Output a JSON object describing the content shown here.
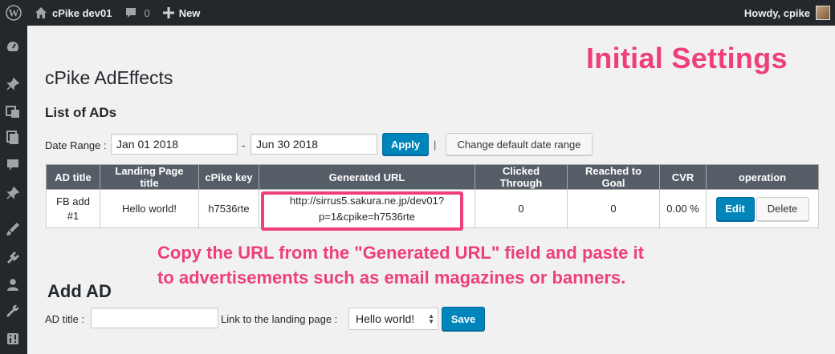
{
  "adminbar": {
    "site_name": "cPike dev01",
    "comments_count": "0",
    "new_label": "New",
    "greeting": "Howdy, cpike"
  },
  "annotations": {
    "title": "Initial Settings",
    "line1": "Copy the URL from the \"Generated URL\" field and paste it",
    "line2": "to advertisements such as email magazines or banners.",
    "color": "#ee3f7c"
  },
  "page": {
    "title": "cPike AdEffects",
    "list_heading": "List of ADs"
  },
  "date_range": {
    "label": "Date Range :",
    "start": "Jan 01 2018",
    "separator": "-",
    "end": "Jun 30 2018",
    "apply_label": "Apply",
    "divider": "|",
    "default_label": "Change default date range"
  },
  "table": {
    "headers": [
      "AD title",
      "Landing Page title",
      "cPike key",
      "Generated URL",
      "Clicked Through",
      "Reached to Goal",
      "CVR",
      "operation"
    ],
    "rows": [
      {
        "ad_title_line1": "FB add",
        "ad_title_line2": "#1",
        "landing_page": "Hello world!",
        "key": "h7536rte",
        "url_line1": "http://sirrus5.sakura.ne.jp/dev01?",
        "url_line2": "p=1&cpike=h7536rte",
        "clicked": "0",
        "reached": "0",
        "cvr": "0.00 %",
        "edit_label": "Edit",
        "delete_label": "Delete"
      }
    ]
  },
  "add_ad": {
    "heading": "Add AD",
    "title_label": "AD title :",
    "title_value": "",
    "landing_label": "Link to the landing page :",
    "landing_selected": "Hello world!",
    "save_label": "Save"
  },
  "colors": {
    "primary": "#0085ba",
    "admin_dark": "#23282d",
    "table_header": "#555d66"
  },
  "icons": {
    "adminbar": [
      "wordpress-icon",
      "home-icon",
      "comment-icon",
      "plus-icon"
    ],
    "sidebar": [
      "dashboard-icon",
      "pin-icon",
      "media-icon",
      "pages-icon",
      "comments-icon",
      "pin-icon",
      "appearance-icon",
      "plugins-icon",
      "users-icon",
      "tools-icon",
      "settings-icon"
    ]
  }
}
